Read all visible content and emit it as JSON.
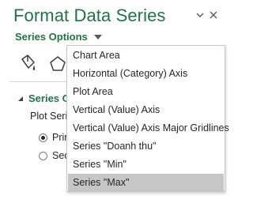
{
  "pane": {
    "title": "Format Data Series",
    "series_options_label": "Series Options",
    "section_title": "Series O",
    "plot_series_label": "Plot Serie",
    "radio_primary": "Prim",
    "radio_secondary": "Sec",
    "radio_selected": "primary"
  },
  "dropdown": {
    "items": [
      "Chart Area",
      "Horizontal (Category) Axis",
      "Plot Area",
      "Vertical (Value) Axis",
      "Vertical (Value) Axis Major Gridlines",
      "Series \"Doanh thu\"",
      "Series \"Min\"",
      "Series \"Max\""
    ],
    "selected_index": 7
  },
  "colors": {
    "accent": "#217346",
    "selected_bg": "#c6c6c6"
  },
  "icons": [
    "collapse-chevron-icon",
    "close-icon",
    "caret-down-icon",
    "paint-bucket-icon",
    "pentagon-shape-icon",
    "triangle-expanded-icon"
  ]
}
